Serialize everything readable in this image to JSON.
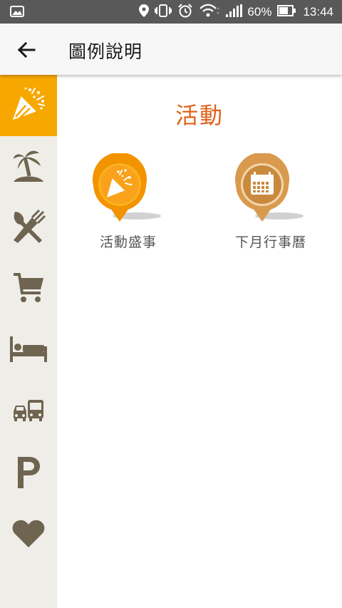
{
  "status_bar": {
    "battery_percent": "60%",
    "time": "13:44",
    "icons": [
      "image-icon",
      "location-icon",
      "vibrate-icon",
      "alarm-icon",
      "wifi-icon",
      "signal-icon",
      "battery-icon"
    ]
  },
  "app_bar": {
    "back_icon": "back-arrow-icon",
    "title": "圖例說明"
  },
  "sidebar": {
    "active_index": 0,
    "active_color": "#f7a800",
    "icon_color": "#6e6450",
    "items": [
      {
        "icon": "party-popper-icon",
        "name": "activities"
      },
      {
        "icon": "palm-tree-island-icon",
        "name": "sightseeing"
      },
      {
        "icon": "fork-spoon-icon",
        "name": "dining"
      },
      {
        "icon": "shopping-cart-icon",
        "name": "shopping"
      },
      {
        "icon": "bed-icon",
        "name": "lodging"
      },
      {
        "icon": "car-bus-icon",
        "name": "transport"
      },
      {
        "icon": "parking-icon",
        "name": "parking"
      },
      {
        "icon": "heart-icon",
        "name": "favorites"
      }
    ]
  },
  "main": {
    "section_title": "活動",
    "title_color": "#e0611a",
    "legend": [
      {
        "label": "活動盛事",
        "icon": "party-popper-pin-icon",
        "color": "#f39300"
      },
      {
        "label": "下月行事曆",
        "icon": "calendar-pin-icon",
        "color": "#d99a4e"
      }
    ]
  }
}
